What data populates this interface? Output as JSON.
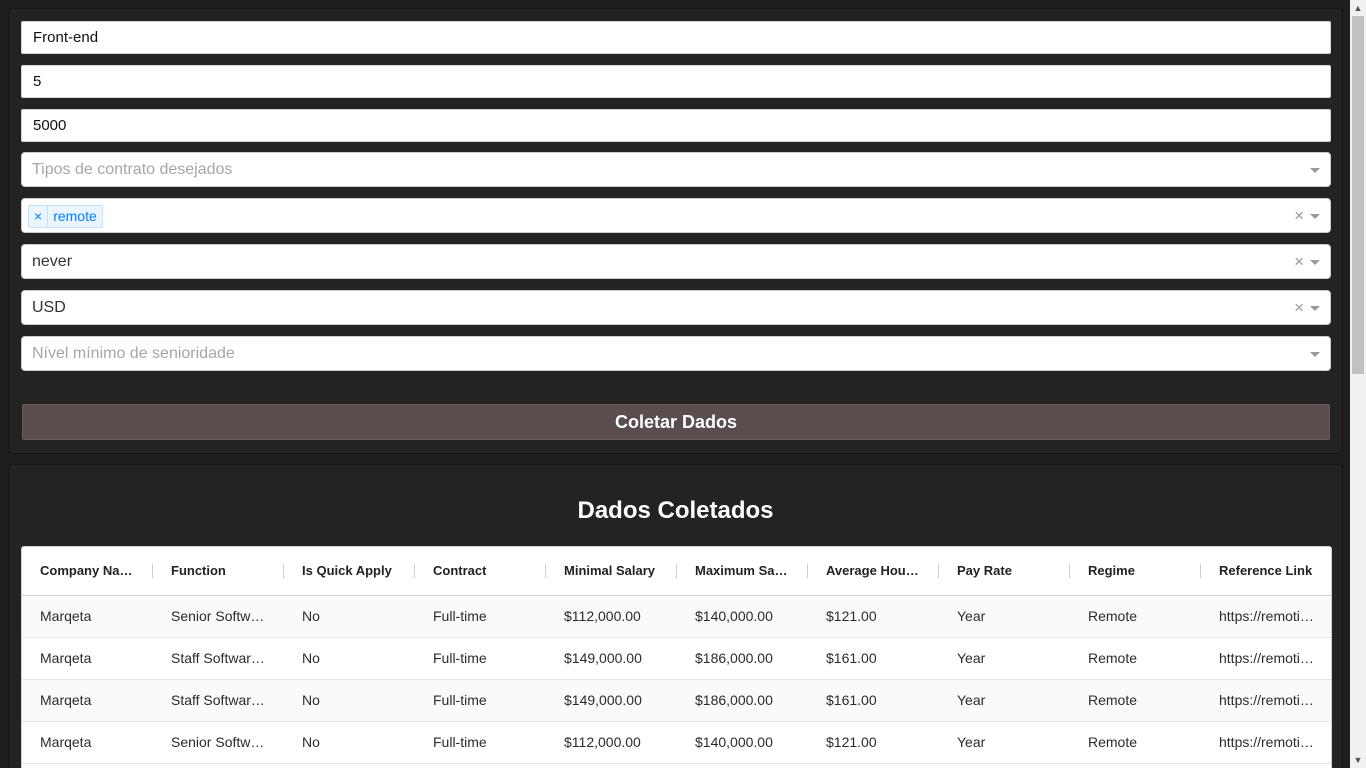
{
  "form": {
    "role_value": "Front-end",
    "number_value": "5",
    "salary_value": "5000",
    "contract_types": {
      "placeholder": "Tipos de contrato desejados"
    },
    "regime": {
      "tag_remove": "×",
      "tag_label": "remote",
      "clear": "×"
    },
    "frequency": {
      "value": "never",
      "clear": "×"
    },
    "currency": {
      "value": "USD",
      "clear": "×"
    },
    "seniority": {
      "placeholder": "Nível mínimo de senioridade"
    },
    "submit_label": "Coletar Dados"
  },
  "results": {
    "title": "Dados Coletados",
    "columns": [
      "Company Name",
      "Function",
      "Is Quick Apply",
      "Contract",
      "Minimal Salary",
      "Maximum Salary",
      "Average Hourly",
      "Pay Rate",
      "Regime",
      "Reference Link"
    ],
    "rows": [
      [
        "Marqeta",
        "Senior Software Engineer",
        "No",
        "Full-time",
        "$112,000.00",
        "$140,000.00",
        "$121.00",
        "Year",
        "Remote",
        "https://remotive.com"
      ],
      [
        "Marqeta",
        "Staff Software Engineer",
        "No",
        "Full-time",
        "$149,000.00",
        "$186,000.00",
        "$161.00",
        "Year",
        "Remote",
        "https://remotive.com"
      ],
      [
        "Marqeta",
        "Staff Software Engineer",
        "No",
        "Full-time",
        "$149,000.00",
        "$186,000.00",
        "$161.00",
        "Year",
        "Remote",
        "https://remotive.com"
      ],
      [
        "Marqeta",
        "Senior Software Engineer",
        "No",
        "Full-time",
        "$112,000.00",
        "$140,000.00",
        "$121.00",
        "Year",
        "Remote",
        "https://remotive.com"
      ]
    ]
  },
  "icons": {
    "select_arrow": "chevron-down-icon",
    "clear": "close-icon"
  }
}
